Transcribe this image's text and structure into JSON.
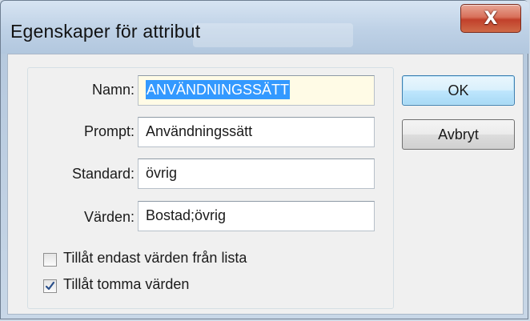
{
  "window": {
    "title": "Egenskaper för attribut",
    "close_glyph": "X"
  },
  "form": {
    "name_label": "Namn:",
    "name_value": "ANVÄNDNINGSSÄTT",
    "prompt_label": "Prompt:",
    "prompt_value": "Användningssätt",
    "default_label": "Standard:",
    "default_value": "övrig",
    "values_label": "Värden:",
    "values_value": "Bostad;övrig"
  },
  "options": [
    {
      "label": "Tillåt endast värden från lista",
      "checked": false
    },
    {
      "label": "Tillåt tomma värden",
      "checked": true
    }
  ],
  "buttons": {
    "ok": "OK",
    "cancel": "Avbryt"
  },
  "colors": {
    "selection": "#3399ff",
    "close_button": "#c1402a",
    "default_button_border": "#3c7fb1"
  }
}
